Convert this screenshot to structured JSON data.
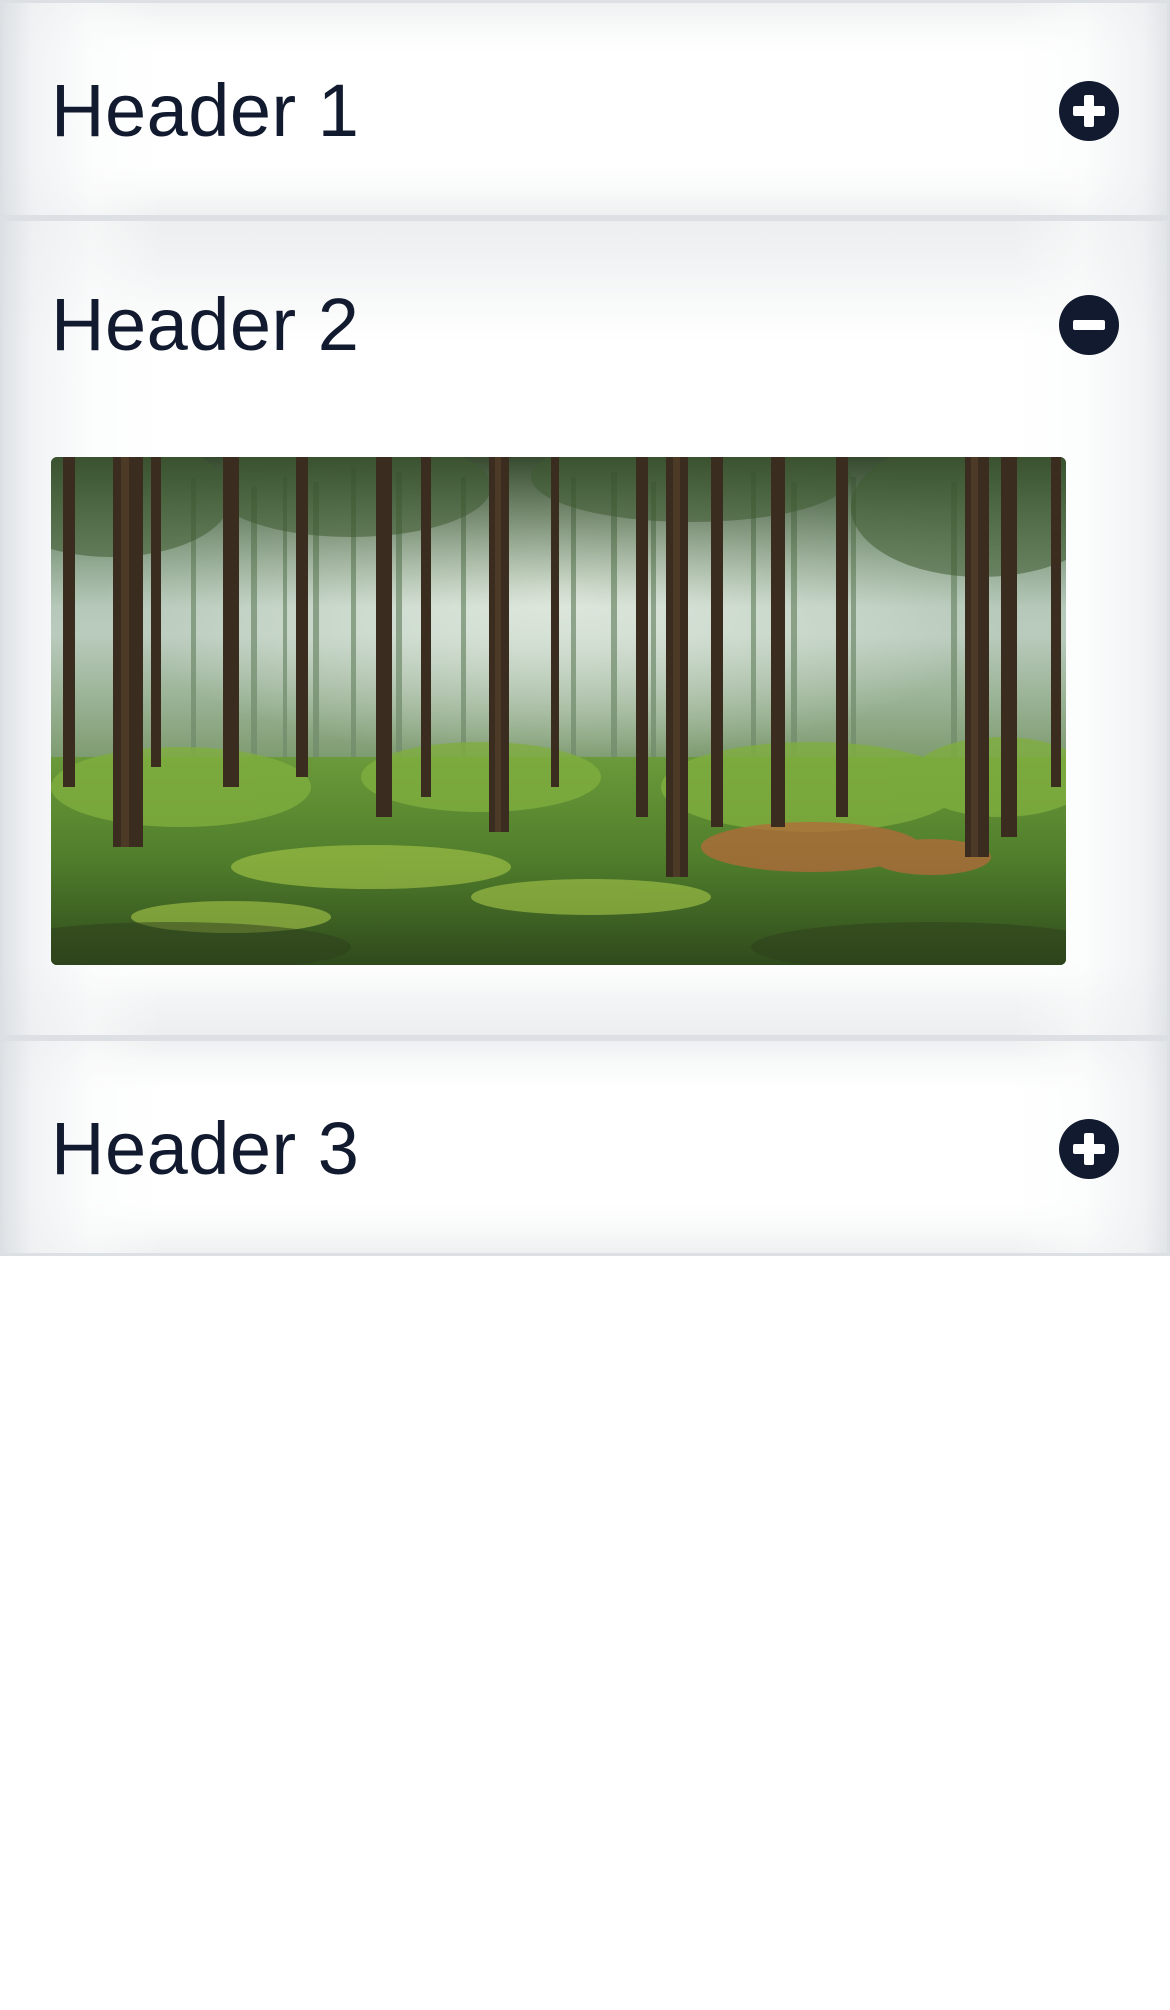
{
  "accordion": {
    "items": [
      {
        "label": "Header 1",
        "expanded": false,
        "icon": "plus-circle-icon"
      },
      {
        "label": "Header 2",
        "expanded": true,
        "icon": "minus-circle-icon",
        "content": {
          "image": "forest-photo"
        }
      },
      {
        "label": "Header 3",
        "expanded": false,
        "icon": "plus-circle-icon"
      }
    ]
  },
  "colors": {
    "text": "#111a2e",
    "icon": "#111a2e",
    "panel_border": "#dcdfe3",
    "background": "#ffffff"
  }
}
